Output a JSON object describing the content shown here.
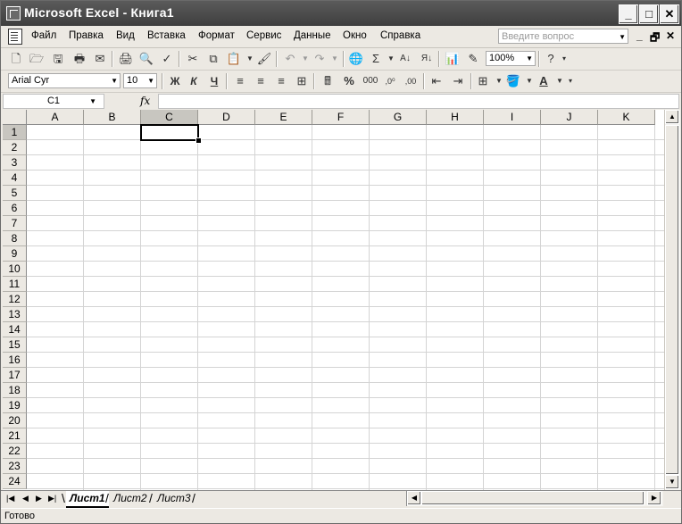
{
  "window": {
    "title": "Microsoft Excel - Книга1"
  },
  "menubar": {
    "items": [
      "Файл",
      "Правка",
      "Вид",
      "Вставка",
      "Формат",
      "Сервис",
      "Данные",
      "Окно",
      "Справка"
    ],
    "help_placeholder": "Введите вопрос"
  },
  "toolbar": {
    "zoom": "100%",
    "font_name": "Arial Cyr",
    "font_size": "10",
    "sigma": "Σ",
    "bold": "Ж",
    "italic": "К",
    "underline": "Ч",
    "percent": "%",
    "thousands": "000",
    "font_color_letter": "А"
  },
  "formula_bar": {
    "cell_ref": "C1",
    "fx": "fx",
    "value": ""
  },
  "grid": {
    "columns": [
      "A",
      "B",
      "C",
      "D",
      "E",
      "F",
      "G",
      "H",
      "I",
      "J",
      "K"
    ],
    "rows": [
      "1",
      "2",
      "3",
      "4",
      "5",
      "6",
      "7",
      "8",
      "9",
      "10",
      "11",
      "12",
      "13",
      "14",
      "15",
      "16",
      "17",
      "18",
      "19",
      "20",
      "21",
      "22",
      "23",
      "24"
    ],
    "active_cell": "C1"
  },
  "sheets": {
    "tabs": [
      "Лист1",
      "Лист2",
      "Лист3"
    ],
    "active": "Лист1"
  },
  "status": {
    "text": "Готово"
  }
}
